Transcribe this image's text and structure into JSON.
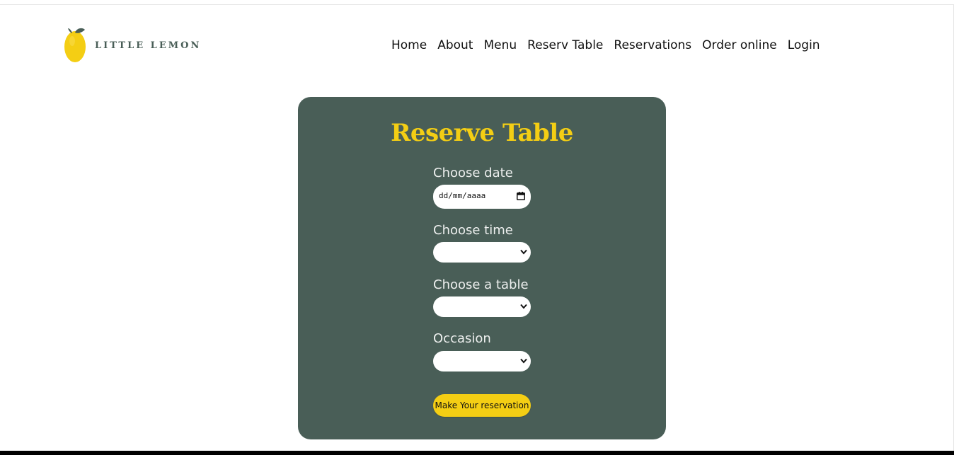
{
  "brand": {
    "logo_text": "LITTLE LEMON",
    "accent_color": "#f4ce14",
    "primary_color": "#495e57"
  },
  "nav": {
    "items": [
      {
        "label": "Home"
      },
      {
        "label": "About"
      },
      {
        "label": "Menu"
      },
      {
        "label": "Reserv Table"
      },
      {
        "label": "Reservations"
      },
      {
        "label": "Order online"
      },
      {
        "label": "Login"
      }
    ]
  },
  "form": {
    "title": "Reserve Table",
    "date": {
      "label": "Choose date",
      "value": "dd/mm/aaaa",
      "icon": "calendar-icon"
    },
    "time": {
      "label": "Choose time",
      "value": "",
      "icon": "chevron-down-icon"
    },
    "table": {
      "label": "Choose a table",
      "value": "",
      "icon": "chevron-down-icon"
    },
    "occasion": {
      "label": "Occasion",
      "value": "",
      "icon": "chevron-down-icon"
    },
    "submit_label": "Make Your reservation"
  }
}
